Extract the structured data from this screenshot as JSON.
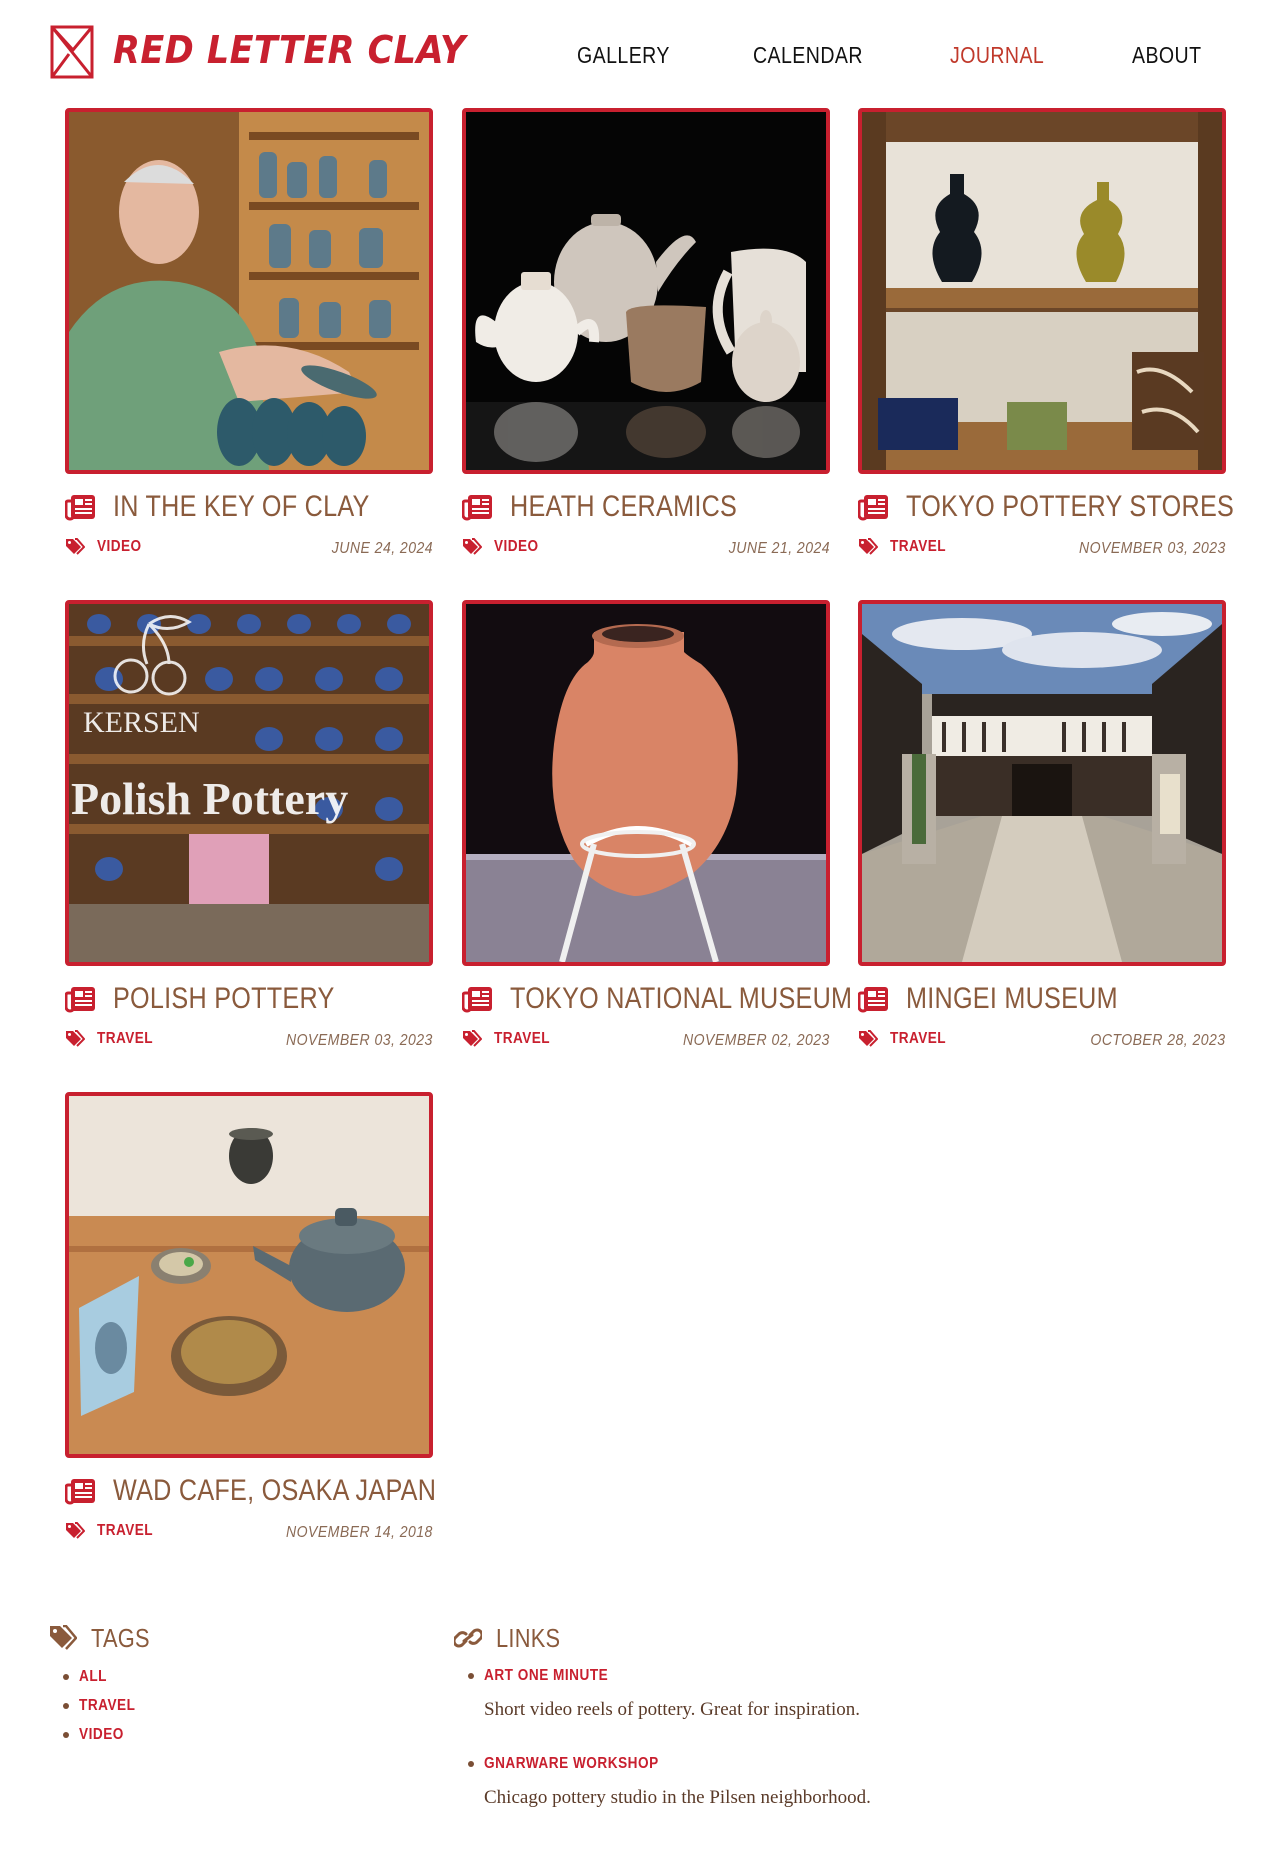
{
  "site": {
    "name": "RED LETTER CLAY",
    "brand_color": "#c8202f"
  },
  "nav": {
    "items": [
      {
        "label": "GALLERY",
        "active": false
      },
      {
        "label": "CALENDAR",
        "active": false
      },
      {
        "label": "JOURNAL",
        "active": true
      },
      {
        "label": "ABOUT",
        "active": false
      }
    ]
  },
  "posts": [
    {
      "title": "IN THE KEY OF CLAY",
      "tag": "VIDEO",
      "date": "JUNE 24, 2024",
      "image": "man-in-pottery-shop"
    },
    {
      "title": "HEATH CERAMICS",
      "tag": "VIDEO",
      "date": "JUNE 21, 2024",
      "image": "white-teapots"
    },
    {
      "title": "TOKYO POTTERY STORES",
      "tag": "TRAVEL",
      "date": "NOVEMBER 03, 2023",
      "image": "vases-on-shelf"
    },
    {
      "title": "POLISH POTTERY",
      "tag": "TRAVEL",
      "date": "NOVEMBER 03, 2023",
      "image": "polish-pottery-storefront"
    },
    {
      "title": "TOKYO NATIONAL MUSEUM",
      "tag": "TRAVEL",
      "date": "NOVEMBER 02, 2023",
      "image": "terracotta-jar"
    },
    {
      "title": "MINGEI MUSEUM",
      "tag": "TRAVEL",
      "date": "OCTOBER 28, 2023",
      "image": "museum-courtyard"
    },
    {
      "title": "WAD CAFE, OSAKA JAPAN",
      "tag": "TRAVEL",
      "date": "NOVEMBER 14, 2018",
      "image": "tea-set-on-tray"
    }
  ],
  "image_text": {
    "storefront_brand": "KERSEN",
    "storefront_sign": "Polish Pottery"
  },
  "footer": {
    "tags": {
      "heading": "TAGS",
      "items": [
        "ALL",
        "TRAVEL",
        "VIDEO"
      ]
    },
    "links": {
      "heading": "LINKS",
      "items": [
        {
          "title": "ART ONE MINUTE",
          "description": "Short video reels of pottery. Great for inspiration."
        },
        {
          "title": "GNARWARE WORKSHOP",
          "description": "Chicago pottery studio in the Pilsen neighborhood."
        }
      ]
    }
  },
  "icons": {
    "logo": "envelope-logo-icon",
    "post": "newspaper-icon",
    "tag": "tags-icon",
    "links": "link-icon"
  }
}
